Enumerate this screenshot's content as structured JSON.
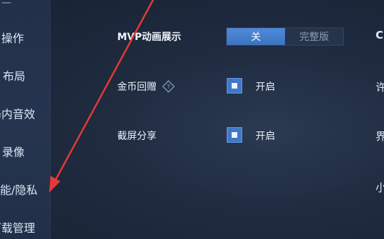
{
  "sidebar": {
    "top_partial": "—",
    "items": [
      {
        "label": "操作"
      },
      {
        "label": "布局"
      },
      {
        "label": "局内音效"
      },
      {
        "label": "录像"
      },
      {
        "label": "功能/隐私"
      },
      {
        "label": "下载管理"
      }
    ]
  },
  "settings": {
    "mvp": {
      "label": "MVP动画展示",
      "options": [
        "关",
        "完整版"
      ],
      "selected": "关"
    },
    "coin_gift": {
      "label": "金币回赠",
      "help_icon": "help-diamond-icon",
      "toggle_label": "开启",
      "checked": true
    },
    "screenshot_share": {
      "label": "截屏分享",
      "toggle_label": "开启",
      "checked": true
    }
  },
  "right_column_partial": [
    "C",
    "许",
    "界",
    "小"
  ],
  "colors": {
    "accent": "#3d78c9",
    "arrow": "#e53935",
    "background": "#1f2b3f"
  }
}
